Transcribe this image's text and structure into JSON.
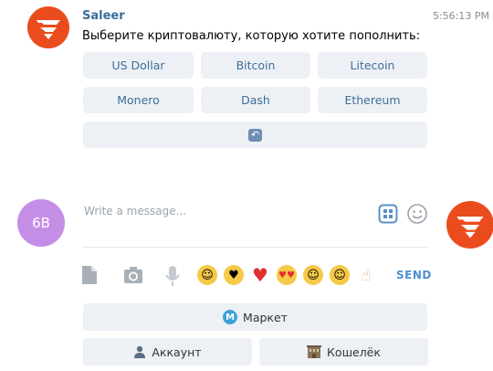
{
  "message": {
    "sender": "Saleer",
    "time": "5:56:13 PM",
    "text": "Выберите криптовалюту, которую хотите пополнить:"
  },
  "currency_buttons": {
    "usd": "US Dollar",
    "bitcoin": "Bitcoin",
    "litecoin": "Litecoin",
    "monero": "Monero",
    "dash": "Dash",
    "ethereum": "Ethereum"
  },
  "refresh_icon": "refresh-icon",
  "composer": {
    "user_initials": "6B",
    "placeholder": "Write a message...",
    "send_label": "SEND"
  },
  "emoji_icons": [
    "laughing-tears-icon",
    "kissing-heart-icon",
    "red-heart-icon",
    "heart-eyes-icon",
    "smiling-icon",
    "grinning-icon",
    "thumbs-up-icon"
  ],
  "bottom_keyboard": {
    "market_label": "Маркет",
    "account_label": "Аккаунт",
    "wallet_label": "Кошелёк"
  },
  "colors": {
    "brand_orange": "#ea4c1d",
    "link_blue": "#3e6e98",
    "send_blue": "#4f8fcf",
    "user_avatar": "#c58ee6",
    "keyboard_button": "#edf1f5"
  }
}
